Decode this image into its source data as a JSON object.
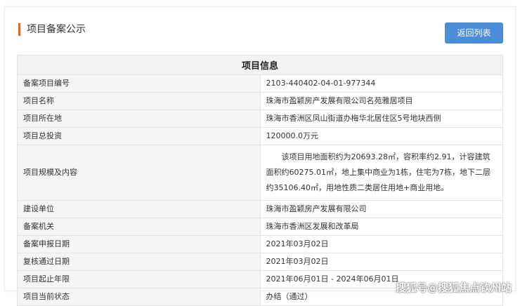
{
  "header": {
    "title": "项目备案公示",
    "back_button": "返回列表"
  },
  "table": {
    "heading": "项目信息",
    "rows": [
      {
        "label": "备案项目编号",
        "value": "2103-440402-04-01-977344"
      },
      {
        "label": "项目名称",
        "value": "珠海市盈颖房产发展有限公司名苑雅居项目"
      },
      {
        "label": "项目所在地",
        "value": "珠海市香洲区凤山街道办梅华北居住区5号地块西侧"
      },
      {
        "label": "项目总投资",
        "value": "120000.0万元"
      },
      {
        "label": "项目规模及内容",
        "value": "该项目用地面积约为20693.28㎡，容积率约2.91，计容建筑面积约60275.01㎡，地上集中商业为1栋，住宅为7栋，地下二层约35106.40㎡，用地性质二类居住用地+商业用地。"
      },
      {
        "label": "建设单位",
        "value": "珠海市盈颖房产发展有限公司"
      },
      {
        "label": "备案机关",
        "value": "珠海市香洲区发展和改革局"
      },
      {
        "label": "备案申报日期",
        "value": "2021年03月02日"
      },
      {
        "label": "复核通过日期",
        "value": "2021年03月02日"
      },
      {
        "label": "项目起止年限",
        "value": "2021年06月01日 - 2024年06月01日"
      },
      {
        "label": "项目当前状态",
        "value": "办结（通过）"
      }
    ]
  },
  "watermark": "搜狐号@搜狐焦点钦州站",
  "colors": {
    "accent": "#e8652a",
    "button": "#4a8ed8"
  }
}
